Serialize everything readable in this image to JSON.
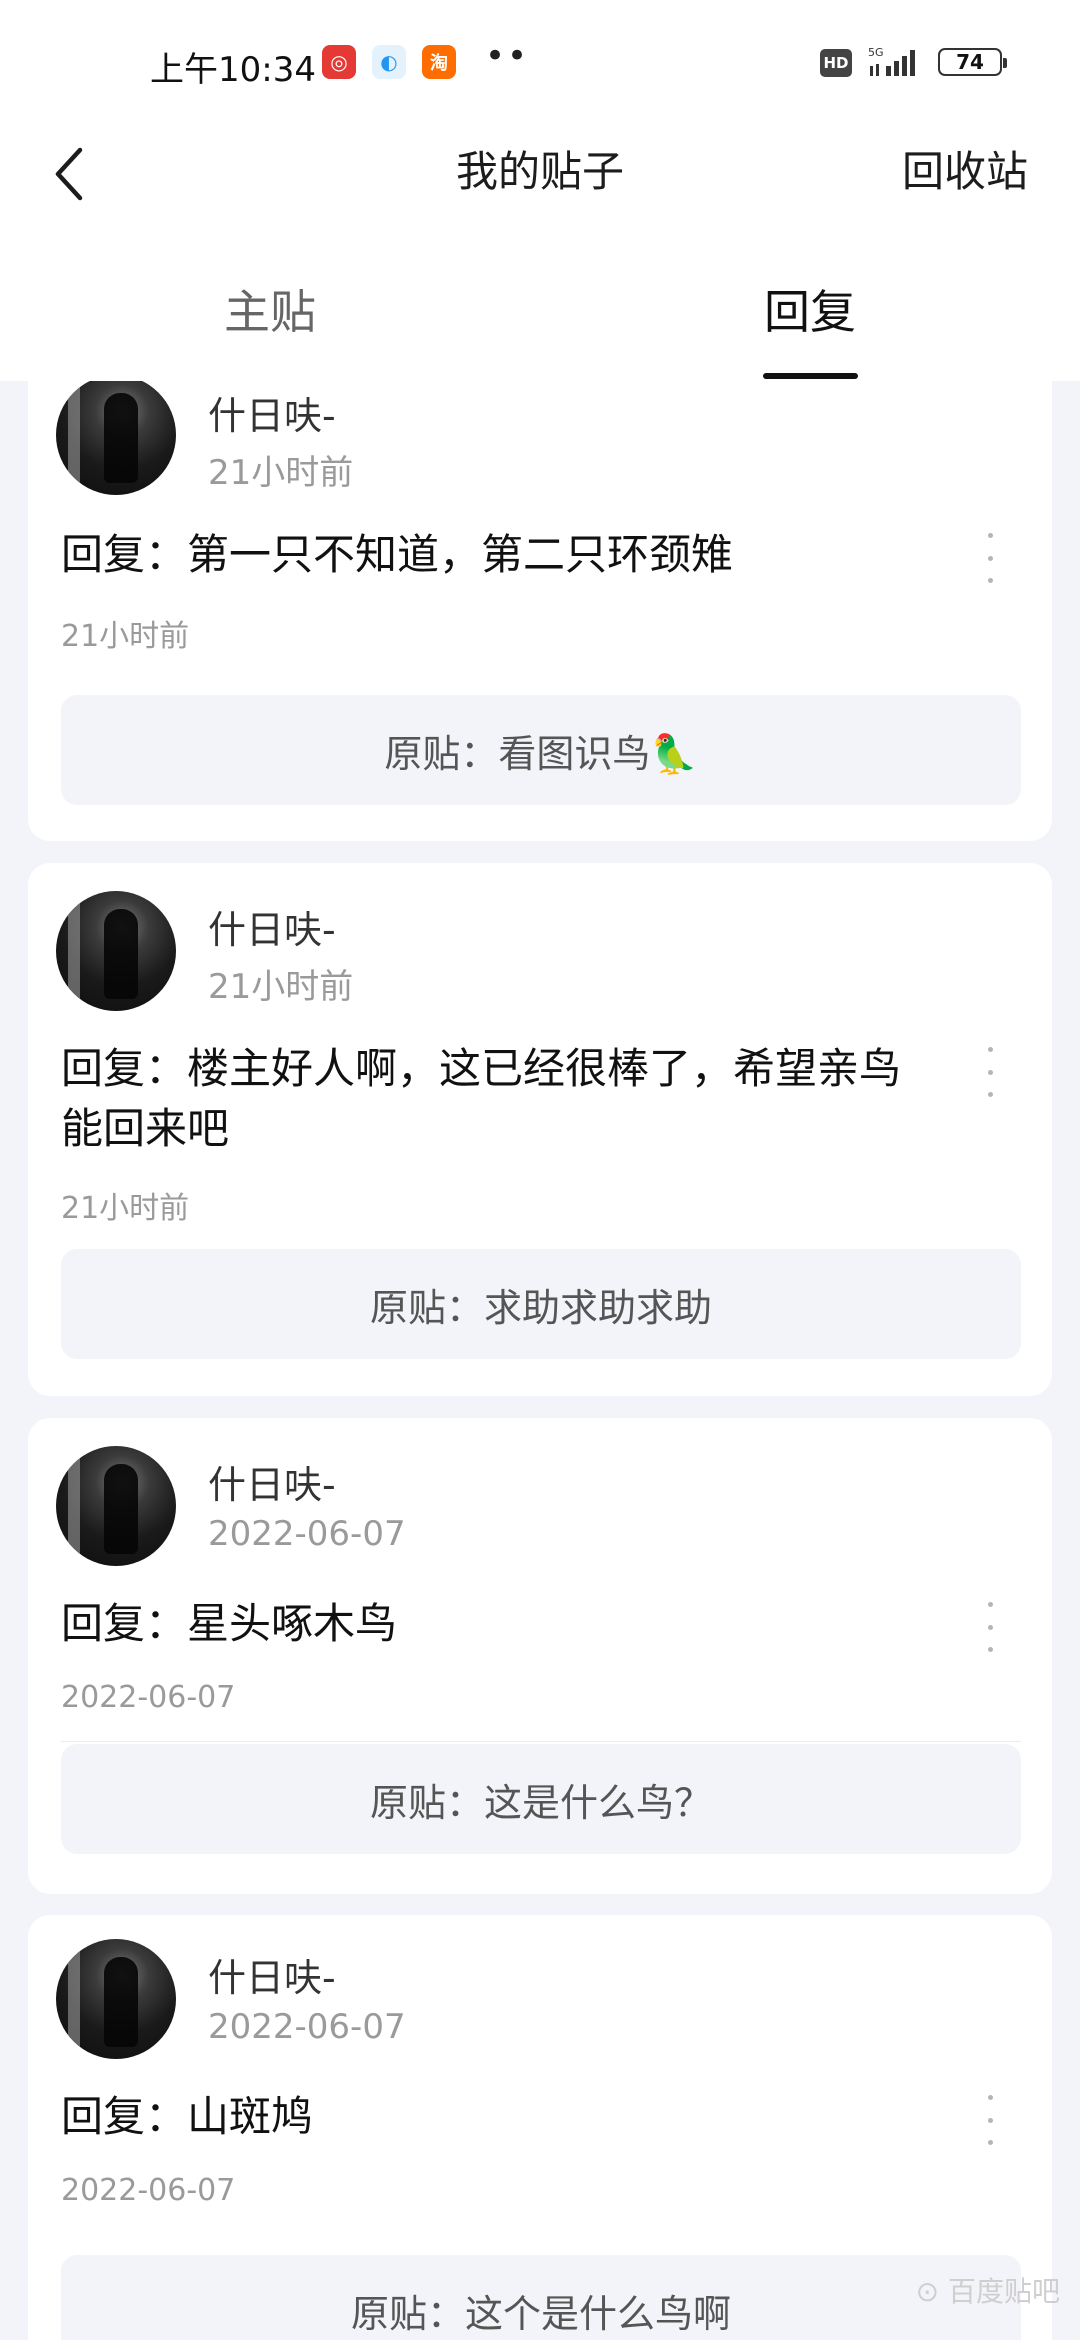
{
  "status_bar": {
    "time": "上午10:34",
    "app_icons": [
      {
        "name": "netease-music-icon",
        "color": "#e53935",
        "glyph": "◎"
      },
      {
        "name": "browser-icon",
        "color": "#2196f3",
        "glyph": "◐"
      },
      {
        "name": "taobao-icon",
        "color": "#ff6d00",
        "glyph": "淘"
      }
    ],
    "more_notifs": "••",
    "hd": "HD",
    "network": "5G",
    "battery": "74"
  },
  "nav": {
    "title": "我的贴子",
    "recycle": "回收站"
  },
  "tabs": {
    "main": "主贴",
    "reply": "回复"
  },
  "posts": [
    {
      "username": "什日呋-",
      "user_time": "21小时前",
      "reply": "回复：第一只不知道，第二只环颈雉",
      "reply_time": "21小时前",
      "original": "原贴：看图识鸟🦜"
    },
    {
      "username": "什日呋-",
      "user_time": "21小时前",
      "reply": "回复：楼主好人啊，这已经很棒了，希望亲鸟能回来吧",
      "reply_time": "21小时前",
      "original": "原贴：求助求助求助"
    },
    {
      "username": "什日呋-",
      "user_time": "2022-06-07",
      "reply": "回复：星头啄木鸟",
      "reply_time": "2022-06-07",
      "original": "原贴：这是什么鸟？"
    },
    {
      "username": "什日呋-",
      "user_time": "2022-06-07",
      "reply": "回复：山斑鸠",
      "reply_time": "2022-06-07",
      "original": "原贴：这个是什么鸟啊"
    }
  ],
  "watermark": "⊙ 百度贴吧"
}
